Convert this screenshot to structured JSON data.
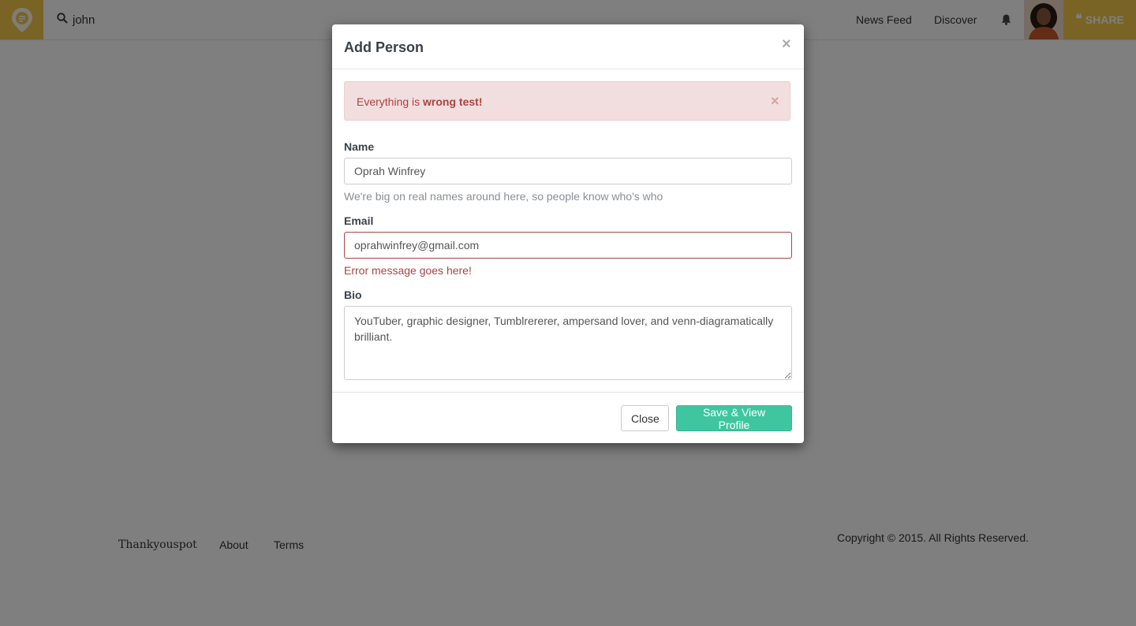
{
  "nav": {
    "search_text": "john",
    "news_feed": "News Feed",
    "discover": "Discover",
    "share_label": "SHARE"
  },
  "footer": {
    "brand": "Thankyouspot",
    "about": "About",
    "terms": "Terms",
    "copyright": "Copyright © 2015. All Rights Reserved."
  },
  "modal": {
    "title": "Add Person",
    "close_symbol": "×",
    "alert": {
      "prefix": "Everything is ",
      "strong": "wrong test!",
      "close_symbol": "×"
    },
    "name": {
      "label": "Name",
      "value": "Oprah Winfrey",
      "help": "We're big on real names around here, so people know who's who"
    },
    "email": {
      "label": "Email",
      "value": "oprahwinfrey@gmail.com",
      "error": "Error message goes here!"
    },
    "bio": {
      "label": "Bio",
      "value": "YouTuber, graphic designer, Tumblrererer, ampersand lover, and venn-diagramatically brilliant."
    },
    "buttons": {
      "close": "Close",
      "save": "Save & View Profile"
    }
  },
  "colors": {
    "brand_yellow": "#f2c94c",
    "save_green": "#3ec6a0",
    "error_red": "#a94442",
    "alert_bg": "#f2dede"
  }
}
